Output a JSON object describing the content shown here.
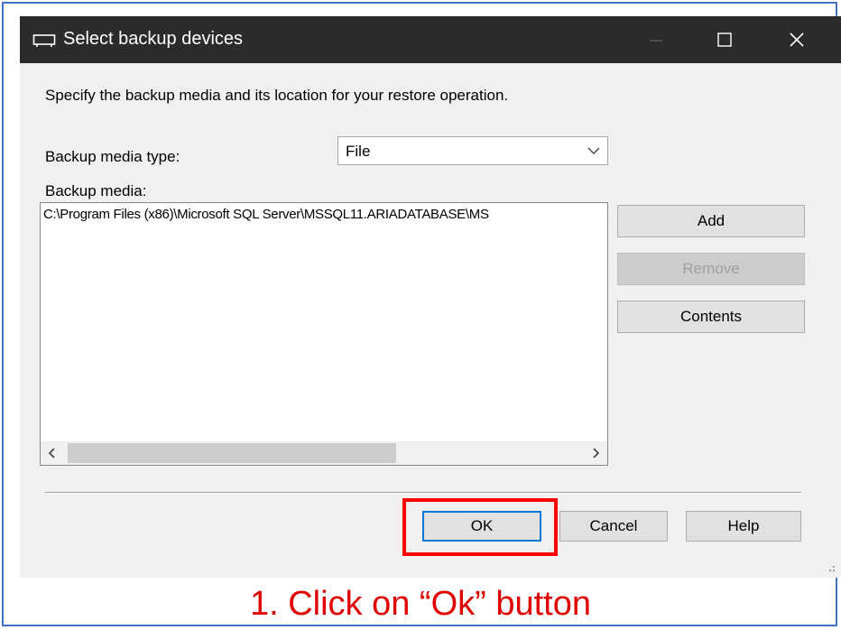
{
  "dialog": {
    "title": "Select backup devices",
    "title_icon": "backup-device-icon",
    "window_controls": [
      "minimize-icon",
      "maximize-icon",
      "close-icon"
    ]
  },
  "instruction": "Specify the backup media and its location for your restore operation.",
  "backup_media_type": {
    "label": "Backup media type:",
    "selected": "File"
  },
  "backup_media": {
    "label": "Backup media:",
    "items": [
      "C:\\Program Files (x86)\\Microsoft SQL Server\\MSSQL11.ARIADATABASE\\MS"
    ]
  },
  "side_buttons": {
    "add": "Add",
    "remove": "Remove",
    "contents": "Contents"
  },
  "footer_buttons": {
    "ok": "OK",
    "cancel": "Cancel",
    "help": "Help"
  },
  "annotation": {
    "caption": "1. Click on “Ok” button",
    "highlight_color": "#ff0000"
  },
  "colors": {
    "titlebar": "#2b2b2b",
    "dialog_bg": "#f0f0f0",
    "focus_blue": "#0078d7",
    "caption_red": "#e00000"
  }
}
